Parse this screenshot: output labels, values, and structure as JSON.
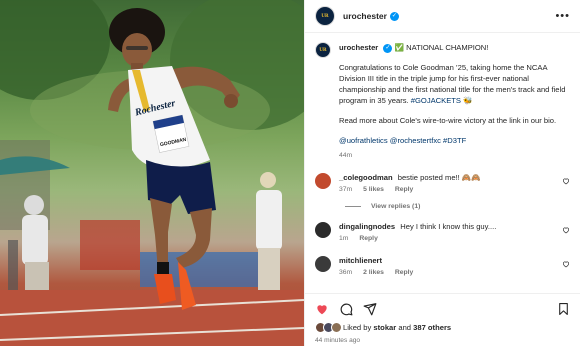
{
  "post": {
    "username": "urochester",
    "verified_mark": "✓",
    "more_label": "•••",
    "avatar_text": "UR",
    "caption": {
      "line1_prefix": "✅",
      "line1_text": "NATIONAL CHAMPION!",
      "paragraph": "Congratulations to Cole Goodman ’25, taking home the NCAA Division III title in the triple jump for his first-ever national championship and the first national title for the men's track and field program in 35 years.",
      "paragraph_tag": "#GOJACKETS",
      "paragraph_emoji": "🐝",
      "paragraph2": "Read more about Cole's wire-to-wire victory at the link in our bio.",
      "tags_line": "@uofrathletics @rochestertfxc #D3TF",
      "time": "44m"
    },
    "comments": [
      {
        "user": "_colegoodman",
        "text": "bestie posted me!! 🙈🙈",
        "time": "37m",
        "likes": "5 likes",
        "reply": "Reply",
        "avatar_color": "#c24a2e"
      },
      {
        "user": "dingalingnodes",
        "text": "Hey I think I know this guy....",
        "time": "1m",
        "reply": "Reply",
        "avatar_color": "#2b2b2b"
      },
      {
        "user": "mitchlienert",
        "text": "",
        "time": "36m",
        "likes": "2 likes",
        "reply": "Reply",
        "avatar_color": "#3a3a3a"
      }
    ],
    "view_replies": "View replies (1)",
    "likes": {
      "prefix": "Liked by",
      "user": "stokar",
      "conj": "and",
      "others": "387 others"
    },
    "time_ago": "44 minutes ago",
    "icons": [
      "heart-filled-icon",
      "comment-icon",
      "share-icon",
      "bookmark-icon"
    ],
    "colors": {
      "heart": "#ed4956",
      "link": "#00376b",
      "verified": "#0095f6"
    }
  },
  "photo": {
    "jersey_text": "Rochester",
    "bib_text": "GOODMAN"
  }
}
